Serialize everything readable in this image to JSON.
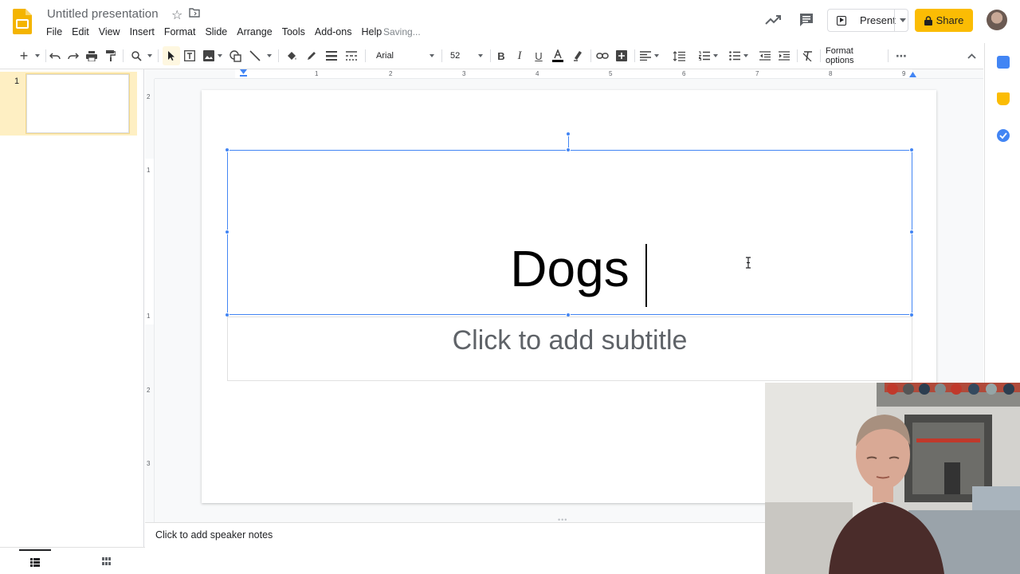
{
  "app": {
    "doc_title": "Untitled presentation",
    "status": "Saving..."
  },
  "menu": [
    "File",
    "Edit",
    "View",
    "Insert",
    "Format",
    "Slide",
    "Arrange",
    "Tools",
    "Add-ons",
    "Help"
  ],
  "header": {
    "present_label": "Present",
    "share_label": "Share"
  },
  "toolbar": {
    "font": "Arial",
    "font_size": "52",
    "format_options": "Format options",
    "more_label": "⋯"
  },
  "ruler": {
    "h_ticks": [
      "1",
      "2",
      "3",
      "4",
      "5",
      "6",
      "7",
      "8",
      "9"
    ],
    "v_ticks": [
      "2",
      "1",
      "1",
      "2",
      "3"
    ]
  },
  "filmstrip": {
    "slides": [
      {
        "number": "1"
      }
    ]
  },
  "slide": {
    "title": "Dogs",
    "subtitle_placeholder": "Click to add subtitle"
  },
  "notes": {
    "placeholder": "Click to add speaker notes"
  },
  "colors": {
    "accent": "#4285f4",
    "share": "#fbbc04",
    "selected_slide": "#feefc3"
  },
  "icons": [
    "slides-logo",
    "star-icon",
    "folder-icon",
    "activity-icon",
    "comment-icon",
    "present-icon",
    "lock-icon",
    "calendar-icon",
    "keep-icon",
    "tasks-icon"
  ]
}
